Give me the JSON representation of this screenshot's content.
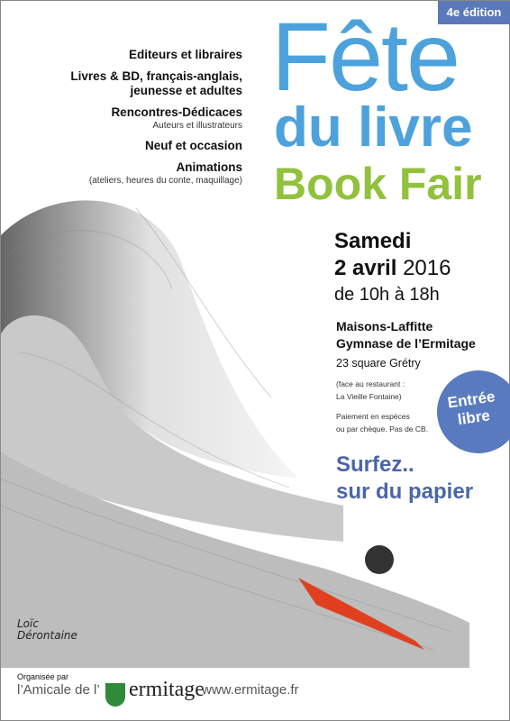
{
  "badge": "4e édition",
  "features": [
    {
      "title": "Editeurs et libraires"
    },
    {
      "title": "Livres & BD, français-anglais,",
      "title2": "jeunesse et adultes"
    },
    {
      "title": "Rencontres-Dédicaces",
      "sub": "Auteurs et illustrateurs"
    },
    {
      "title": "Neuf et occasion"
    },
    {
      "title": "Animations",
      "sub": "(ateliers, heures du conte, maquillage)"
    }
  ],
  "title": {
    "line1": "Fête",
    "line2": "du livre",
    "line3": "Book Fair"
  },
  "date": {
    "day": "Samedi",
    "date_bold": "2 avril",
    "year": "2016",
    "hours": "de 10h à 18h"
  },
  "place": {
    "city": "Maisons-Laffitte",
    "venue": "Gymnase de l’Ermitage",
    "address": "23 square Grétry",
    "note1": "(face au restaurant :",
    "note2": "La Vieille Fontaine)",
    "pay1": "Paiement en espèces",
    "pay2": "ou par chèque. Pas de CB."
  },
  "entry": {
    "line1": "Entrée",
    "line2": "libre"
  },
  "slogan": {
    "line1": "Surfez..",
    "line2": "sur du papier"
  },
  "signature": {
    "line1": "Loïc",
    "line2": "Dérontaine"
  },
  "footer": {
    "organised": "Organisée par",
    "amicale": "l’Amicale de l’",
    "brand": "ermitage",
    "website": "www.ermitage.fr"
  },
  "colors": {
    "blue": "#4da2dc",
    "green": "#92c13e",
    "badge": "#5b78b8",
    "circle": "#5a7abf"
  }
}
